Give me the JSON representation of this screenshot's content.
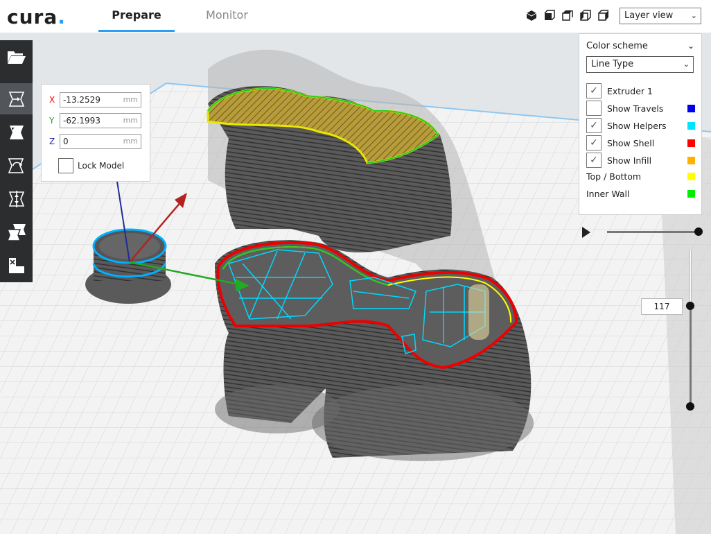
{
  "app": {
    "logo_text": "cura",
    "logo_dot": "."
  },
  "tabs": [
    {
      "label": "Prepare",
      "active": true
    },
    {
      "label": "Monitor",
      "active": false
    }
  ],
  "view_buttons": [
    "3d-view-icon",
    "front-view-icon",
    "top-view-icon",
    "left-view-icon",
    "right-view-icon"
  ],
  "view_mode": {
    "selected": "Layer view"
  },
  "toolbar": {
    "items": [
      "open-file-icon",
      "move-tool-icon",
      "scale-tool-icon",
      "rotate-tool-icon",
      "mirror-tool-icon",
      "per-model-settings-icon",
      "support-blocker-icon"
    ],
    "active": "move-tool-icon"
  },
  "move_panel": {
    "x_label": "X",
    "x_value": "-13.2529",
    "y_label": "Y",
    "y_value": "-62.1993",
    "z_label": "Z",
    "z_value": "0",
    "unit": "mm",
    "lock_label": "Lock Model"
  },
  "legend": {
    "title": "Color scheme",
    "scheme": "Line Type",
    "items": [
      {
        "label": "Extruder 1",
        "checked": true,
        "color": null
      },
      {
        "label": "Show Travels",
        "checked": false,
        "color": "#0000ee"
      },
      {
        "label": "Show Helpers",
        "checked": true,
        "color": "#00e5ff"
      },
      {
        "label": "Show Shell",
        "checked": true,
        "color": "#ff0000"
      },
      {
        "label": "Show Infill",
        "checked": true,
        "color": "#ffb000"
      }
    ],
    "plain_items": [
      {
        "label": "Top / Bottom",
        "color": "#ffff00"
      },
      {
        "label": "Inner Wall",
        "color": "#00ee00"
      }
    ]
  },
  "layer_slider": {
    "current_layer": "117"
  },
  "colors": {
    "accent": "#2a9df4",
    "build_plate": "#f2f2f2",
    "grid": "#d0d0d0",
    "model": "#555555",
    "ghost": "#b8b8b8"
  }
}
